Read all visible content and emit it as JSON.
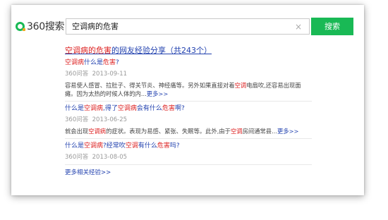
{
  "header": {
    "logo_text": "360搜索",
    "search_value": "空调病的危害",
    "clear_symbol": "×",
    "search_button": "搜索"
  },
  "results": {
    "heading_hl": "空调病的危害",
    "heading_rest": "的网友经验分享（共243个）",
    "items": [
      {
        "title_parts": [
          "空调病",
          "什么是",
          "危害",
          "?"
        ],
        "source": "360问答",
        "date": "2013-09-11",
        "snippet_a": "容易使人感冒、拉肚子、得关节炎、神经痛等。另外如果直接对着",
        "snippet_hl": "空调",
        "snippet_b": "电扇吹,还容易出现面瘫。因为太热的时候人体的内...",
        "more": "更多>>"
      },
      {
        "title": [
          "什么是",
          "空调病",
          ",得了",
          "空调病",
          "会有什么",
          "危害",
          "啊?"
        ],
        "source": "360问答",
        "date": "2013-06-25",
        "snippet_a": "就会出现",
        "snippet_hl1": "空调病",
        "snippet_b": "的症状。表现为易感、紧张、失眠等。此外,由于",
        "snippet_hl2": "空调",
        "snippet_c": "房间通常县...",
        "more": "更多>>"
      },
      {
        "title": [
          "什么是",
          "空调病",
          "?经常吹",
          "空调",
          "有什么",
          "危害",
          "吗?"
        ],
        "source": "360问答",
        "date": "2013-08-05"
      }
    ],
    "more_link": "更多相关经验>>"
  }
}
